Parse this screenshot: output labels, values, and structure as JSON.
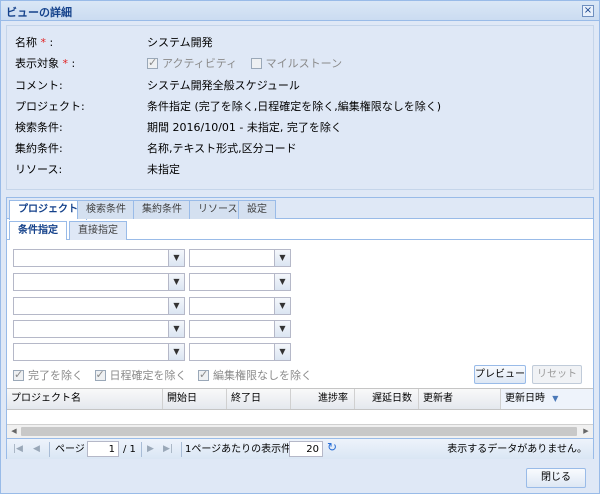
{
  "window": {
    "title": "ビューの詳細",
    "close_icon": "×"
  },
  "details": {
    "name_label": "名称",
    "name_value": "システム開発",
    "target_label": "表示対象",
    "required_mark": "*",
    "colon": ":",
    "activity_label": "アクティビティ",
    "activity_checked": true,
    "milestone_label": "マイルストーン",
    "milestone_checked": false,
    "comment_label": "コメント:",
    "comment_value": "システム開発全般スケジュール",
    "project_label": "プロジェクト:",
    "project_value": "条件指定 (完了を除く,日程確定を除く,編集権限なしを除く)",
    "search_label": "検索条件:",
    "search_value": "期間 2016/10/01 - 未指定, 完了を除く",
    "aggregate_label": "集約条件:",
    "aggregate_value": "名称,テキスト形式,区分コード",
    "resource_label": "リソース:",
    "resource_value": "未指定"
  },
  "tabs": [
    "プロジェクト",
    "検索条件",
    "集約条件",
    "リソース",
    "設定"
  ],
  "active_tab": "プロジェクト",
  "subtabs": [
    "条件指定",
    "直接指定"
  ],
  "active_subtab": "条件指定",
  "filters": {
    "exclude_completed": "完了を除く",
    "exclude_schedule_fixed": "日程確定を除く",
    "exclude_no_permission": "編集権限なしを除く",
    "all_checked": true
  },
  "buttons": {
    "preview": "プレビュー",
    "reset": "リセット",
    "close": "閉じる"
  },
  "grid": {
    "columns": [
      "プロジェクト名",
      "開始日",
      "終了日",
      "進捗率",
      "遅延日数",
      "更新者",
      "更新日時"
    ],
    "sorted_column": "更新日時",
    "sort_direction": "desc",
    "rows": []
  },
  "pager": {
    "page_label": "ページ",
    "page_value": "1",
    "total_pages": "/ 1",
    "per_page_label": "1ページあたりの表示件数",
    "per_page_value": "20",
    "empty_message": "表示するデータがありません。"
  },
  "colors": {
    "header_text": "#15428b",
    "required": "#e02020",
    "panel_bg": "#dfe8f6",
    "border": "#99bbe8",
    "refresh_icon": "#2a6fd6"
  }
}
